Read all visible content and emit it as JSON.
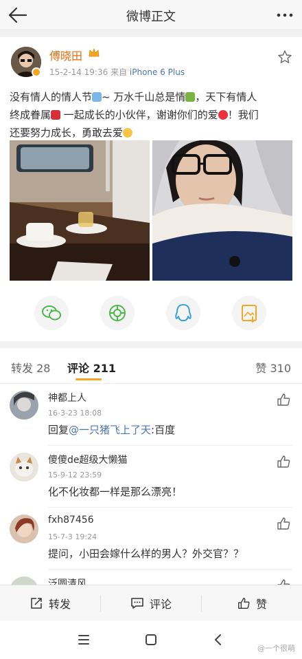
{
  "header": {
    "title": "微博正文"
  },
  "post": {
    "username": "傅晓田",
    "time": "15-2-14 19:36",
    "source_prefix": "来自",
    "source_device": "iPhone 6 Plus",
    "text_line1": "没有情人的情人节",
    "text_line1b": "~ 万水千山总是情",
    "text_line1c": "，天下有情人",
    "text_line2": "终成眷属",
    "text_line2b": " 一起成长的小伙伴，谢谢你们的爱",
    "text_line2c": "！我们",
    "text_line3": "还要努力成长，勇敢去爱"
  },
  "share_buttons": [
    "wechat-icon",
    "moments-icon",
    "qq-icon",
    "save-image-icon"
  ],
  "tabs": {
    "repost_label": "转发",
    "repost_count": "28",
    "comment_label": "评论",
    "comment_count": "211",
    "like_label": "赞",
    "like_count": "310"
  },
  "comments": [
    {
      "name": "神都上人",
      "time": "16-3-23 18:08",
      "text_prefix": "回复",
      "mention": "@一只猪飞上了天",
      "text_suffix": ":百度"
    },
    {
      "name": "傻傻de超级大懒猫",
      "time": "15-9-12 23:59",
      "text": "化不化妆都一样是那么漂亮！"
    },
    {
      "name": "fxh87456",
      "time": "15-7-3 19:24",
      "text": "提问，小田会嫁什么样的男人？外交官？？"
    },
    {
      "name": "泛圆清风"
    }
  ],
  "bottom_bar": {
    "repost": "转发",
    "comment": "评论",
    "like": "赞"
  },
  "watermark": "@一个很萌",
  "colors": {
    "accent": "#f5a623",
    "username": "#e86b0d",
    "link": "#4a74b6"
  }
}
